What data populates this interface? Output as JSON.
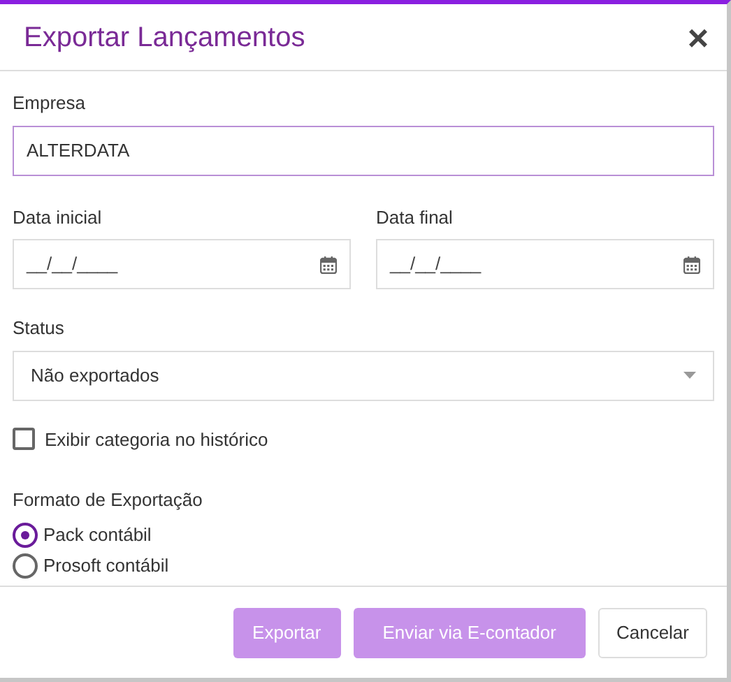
{
  "dialog": {
    "title": "Exportar Lançamentos",
    "close": "×"
  },
  "empresa": {
    "label": "Empresa",
    "value": "ALTERDATA"
  },
  "dates": [
    {
      "label": "Data inicial",
      "placeholder": "__/__/____"
    },
    {
      "label": "Data final",
      "placeholder": "__/__/____"
    }
  ],
  "status": {
    "label": "Status",
    "value": "Não exportados"
  },
  "checkbox": {
    "label": "Exibir categoria no histórico",
    "checked": false
  },
  "format": {
    "label": "Formato de Exportação",
    "options": [
      {
        "label": "Pack contábil",
        "selected": true
      },
      {
        "label": "Prosoft contábil",
        "selected": false
      }
    ]
  },
  "buttons": [
    {
      "label": "Exportar",
      "kind": "primary"
    },
    {
      "label": "Enviar via E-contador",
      "kind": "primary"
    },
    {
      "label": "Cancelar",
      "kind": "secondary"
    }
  ]
}
